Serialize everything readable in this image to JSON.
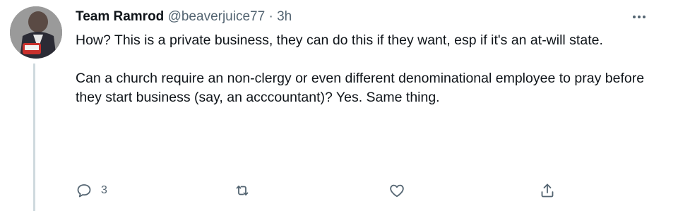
{
  "tweet": {
    "display_name": "Team Ramrod",
    "handle": "@beaverjuice77",
    "separator": "·",
    "time": "3h",
    "paragraphs": [
      "How? This is a private business, they can do this if they want, esp if it's an at-will state.",
      "Can a church require an non-clergy or even different denominational employee to pray before they start business (say, an acccountant)? Yes. Same thing."
    ],
    "reply_count": "3",
    "icons": {
      "more": "more-horizontal-icon",
      "reply": "reply-icon",
      "retweet": "retweet-icon",
      "like": "heart-icon",
      "share": "share-icon"
    },
    "colors": {
      "text": "#0f1419",
      "muted": "#536471",
      "thread": "#cfd9de"
    }
  }
}
